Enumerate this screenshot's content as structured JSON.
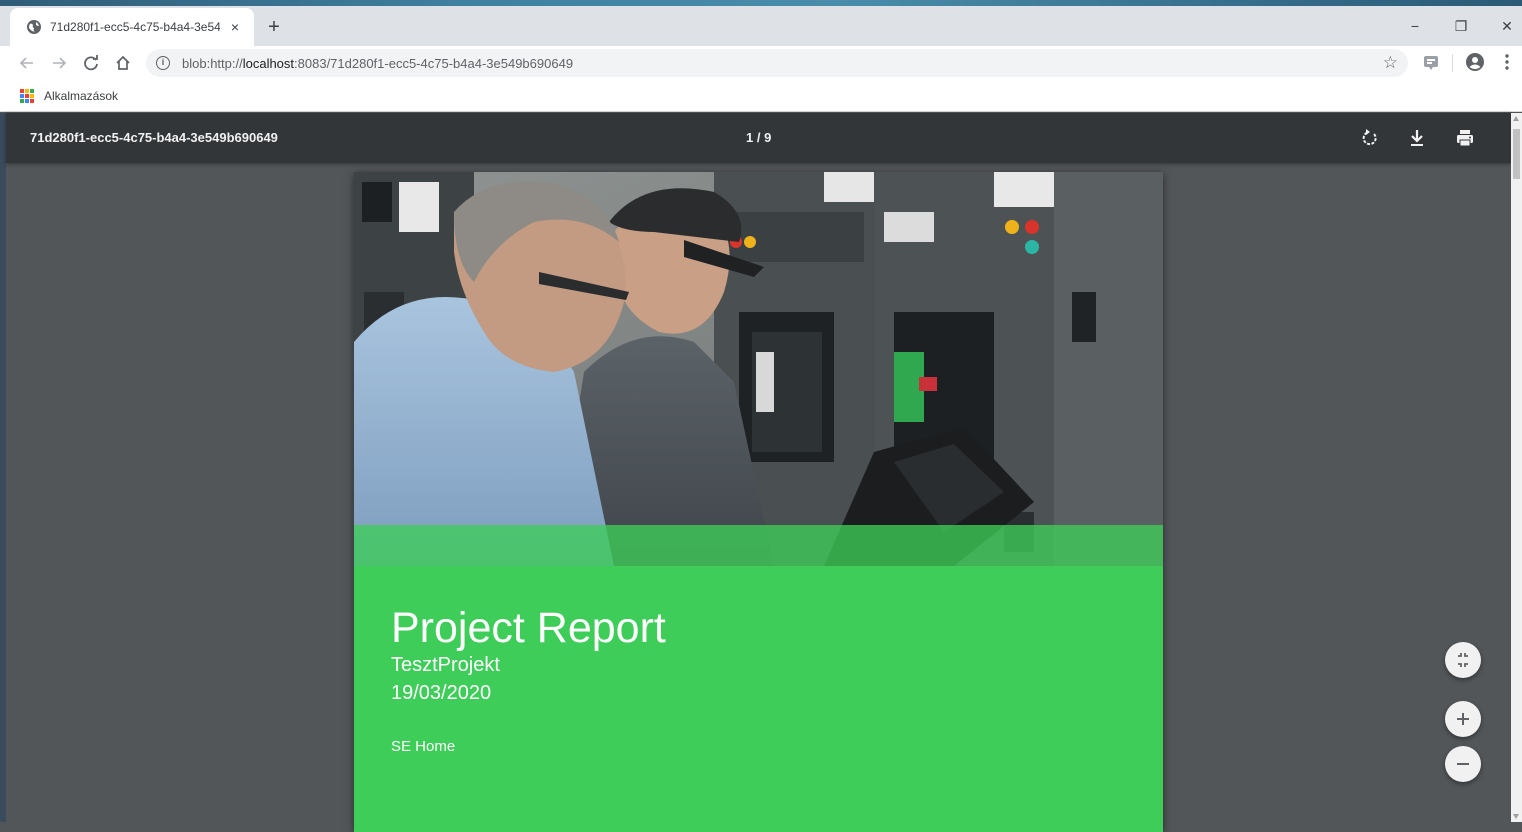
{
  "browser": {
    "tab": {
      "title": "71d280f1-ecc5-4c75-b4a4-3e549b690649",
      "close": "×"
    },
    "new_tab": "+",
    "window_controls": {
      "minimize": "−",
      "restore": "❐",
      "close": "✕"
    },
    "address": {
      "scheme_prefix": "blob:http://",
      "host": "localhost",
      "rest": ":8083/71d280f1-ecc5-4c75-b4a4-3e549b690649"
    },
    "bookmarks": {
      "apps_label": "Alkalmazások"
    }
  },
  "pdf_viewer": {
    "document_title": "71d280f1-ecc5-4c75-b4a4-3e549b690649",
    "page_indicator": "1 / 9",
    "buttons": [
      "rotate-icon",
      "download-icon",
      "print-icon"
    ],
    "zoom_buttons": [
      "fit-to-page-icon",
      "zoom-in-icon",
      "zoom-out-icon"
    ]
  },
  "report": {
    "title": "Project Report",
    "project": "TesztProjekt",
    "date": "19/03/2020",
    "company": "SE Home"
  },
  "colors": {
    "brand_green": "#3dcd58",
    "viewer_toolbar": "#323639",
    "viewer_background": "#525659"
  }
}
